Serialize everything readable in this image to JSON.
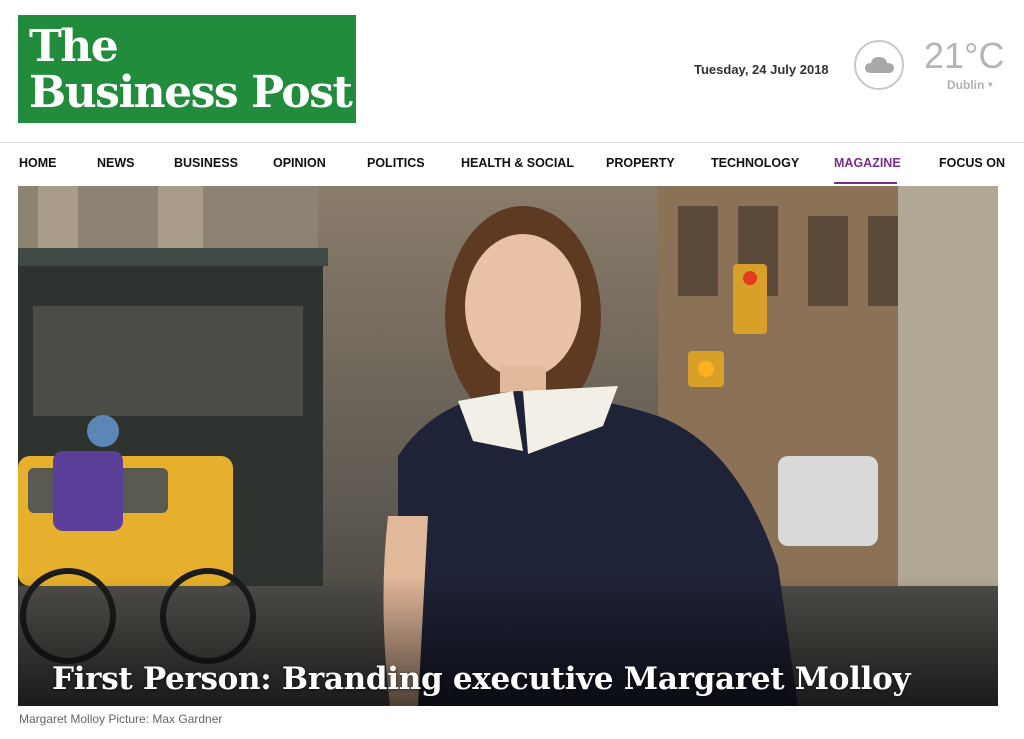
{
  "header": {
    "logo_line1": "The",
    "logo_line2": "Business Post",
    "date": "Tuesday, 24 July 2018",
    "weather": {
      "icon": "cloud-icon",
      "temperature": "21°C",
      "city": "Dublin",
      "city_caret": "▾"
    }
  },
  "nav": {
    "items": [
      {
        "label": "Home"
      },
      {
        "label": "News"
      },
      {
        "label": "Business"
      },
      {
        "label": "Opinion"
      },
      {
        "label": "Politics"
      },
      {
        "label": "Health & Social"
      },
      {
        "label": "Property"
      },
      {
        "label": "Technology"
      },
      {
        "label": "Magazine"
      },
      {
        "label": "Focus On"
      }
    ],
    "active": "Magazine",
    "active_color": "#7a2e8e"
  },
  "article": {
    "headline": "First Person: Branding executive Margaret Molloy",
    "caption": "Margaret Molloy Picture: Max Gardner"
  },
  "colors": {
    "brand_green": "#218d3c"
  }
}
